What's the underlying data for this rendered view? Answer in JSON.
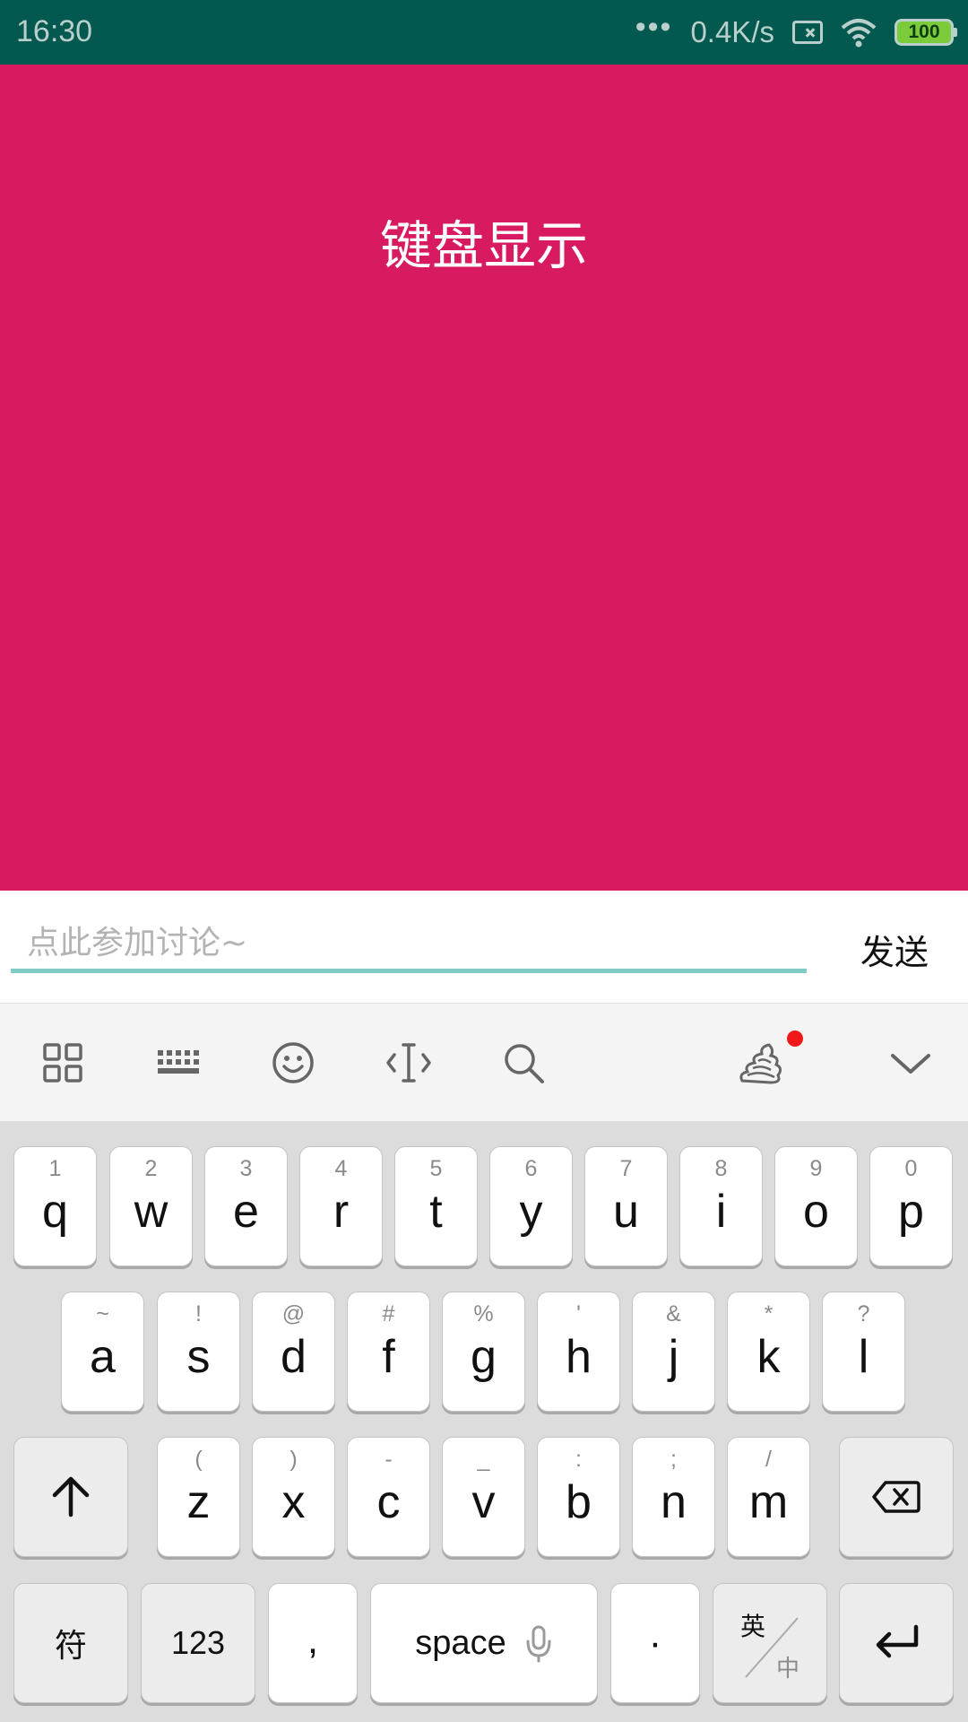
{
  "status_bar": {
    "time": "16:30",
    "dots": "•••",
    "network_speed": "0.4K/s",
    "battery": "100"
  },
  "main": {
    "title": "键盘显示",
    "background_color": "#d81b60"
  },
  "input_bar": {
    "placeholder": "点此参加讨论~",
    "value": "",
    "send_label": "发送"
  },
  "toolbar": {
    "icons": [
      "grid-icon",
      "keyboard-icon",
      "emoji-icon",
      "cursor-icon",
      "search-icon",
      "skin-icon",
      "chevron-down-icon"
    ],
    "badge_color": "#f01818"
  },
  "keyboard": {
    "row1": [
      {
        "hint": "1",
        "letter": "q"
      },
      {
        "hint": "2",
        "letter": "w"
      },
      {
        "hint": "3",
        "letter": "e"
      },
      {
        "hint": "4",
        "letter": "r"
      },
      {
        "hint": "5",
        "letter": "t"
      },
      {
        "hint": "6",
        "letter": "y"
      },
      {
        "hint": "7",
        "letter": "u"
      },
      {
        "hint": "8",
        "letter": "i"
      },
      {
        "hint": "9",
        "letter": "o"
      },
      {
        "hint": "0",
        "letter": "p"
      }
    ],
    "row2": [
      {
        "hint": "~",
        "letter": "a"
      },
      {
        "hint": "!",
        "letter": "s"
      },
      {
        "hint": "@",
        "letter": "d"
      },
      {
        "hint": "#",
        "letter": "f"
      },
      {
        "hint": "%",
        "letter": "g"
      },
      {
        "hint": "'",
        "letter": "h"
      },
      {
        "hint": "&",
        "letter": "j"
      },
      {
        "hint": "*",
        "letter": "k"
      },
      {
        "hint": "?",
        "letter": "l"
      }
    ],
    "row3": [
      {
        "hint": "(",
        "letter": "z"
      },
      {
        "hint": ")",
        "letter": "x"
      },
      {
        "hint": "-",
        "letter": "c"
      },
      {
        "hint": "_",
        "letter": "v"
      },
      {
        "hint": ":",
        "letter": "b"
      },
      {
        "hint": ";",
        "letter": "n"
      },
      {
        "hint": "/",
        "letter": "m"
      }
    ],
    "symbol_label": "符",
    "numbers_label": "123",
    "comma_label": ",",
    "space_label": "space",
    "period_label": "·",
    "lang_top": "英",
    "lang_bottom": "中"
  }
}
